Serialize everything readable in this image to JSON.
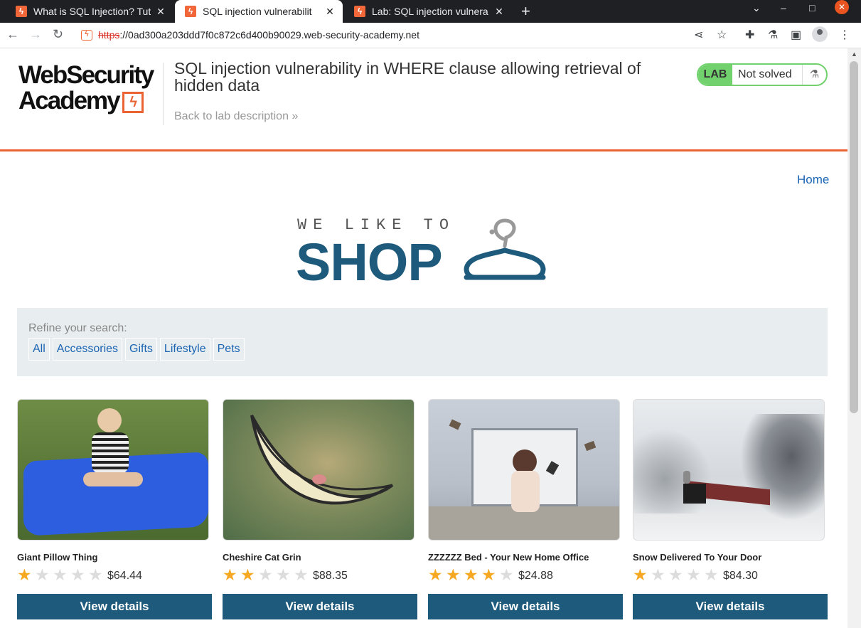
{
  "browser": {
    "tabs": [
      {
        "title": "What is SQL Injection? Tut",
        "active": false
      },
      {
        "title": "SQL injection vulnerabilit",
        "active": true
      },
      {
        "title": "Lab: SQL injection vulnera",
        "active": false
      }
    ],
    "url_scheme": "https",
    "url_rest": "://0ad300a203ddd7f0c872c6d400b90029.web-security-academy.net",
    "new_tab_symbol": "+"
  },
  "header": {
    "logo_line1": "WebSecurity",
    "logo_line2": "Academy",
    "lab_title": "SQL injection vulnerability in WHERE clause allowing retrieval of hidden data",
    "back_link": "Back to lab description",
    "lab_badge": "LAB",
    "lab_status": "Not solved"
  },
  "nav": {
    "home": "Home"
  },
  "shop_logo": {
    "tagline": "WE LIKE TO",
    "word": "SHOP"
  },
  "filters": {
    "label": "Refine your search:",
    "options": [
      "All",
      "Accessories",
      "Gifts",
      "Lifestyle",
      "Pets"
    ]
  },
  "products": [
    {
      "name": "Giant Pillow Thing",
      "rating": 1,
      "price": "$64.44",
      "button": "View details"
    },
    {
      "name": "Cheshire Cat Grin",
      "rating": 2,
      "price": "$88.35",
      "button": "View details"
    },
    {
      "name": "ZZZZZZ Bed - Your New Home Office",
      "rating": 4,
      "price": "$24.88",
      "button": "View details"
    },
    {
      "name": "Snow Delivered To Your Door",
      "rating": 1,
      "price": "$84.30",
      "button": "View details"
    }
  ],
  "colors": {
    "accent_orange": "#ec6333",
    "shop_blue": "#1d5a7c",
    "link_blue": "#1b65b3",
    "lab_green": "#70d16d",
    "star_gold": "#f6a823"
  }
}
